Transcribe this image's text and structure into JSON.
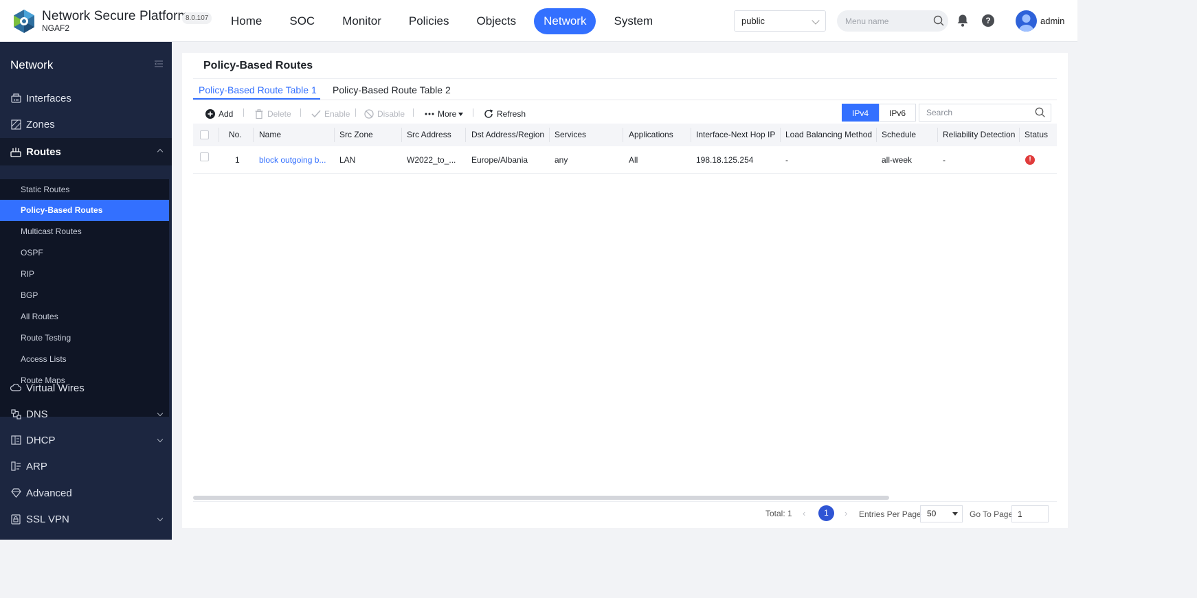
{
  "brand": {
    "title": "Network Secure Platform",
    "subtitle": "NGAF2",
    "version": "8.0.107"
  },
  "nav": {
    "items": [
      "Home",
      "SOC",
      "Monitor",
      "Policies",
      "Objects",
      "Network",
      "System"
    ],
    "active": "Network"
  },
  "header": {
    "vsys_value": "public",
    "search_placeholder": "Menu name",
    "help_glyph": "?",
    "username": "admin"
  },
  "sidebar": {
    "title": "Network",
    "items": [
      {
        "label": "Interfaces",
        "icon": "interfaces-icon"
      },
      {
        "label": "Zones",
        "icon": "zones-icon"
      },
      {
        "label": "Routes",
        "icon": "routes-icon",
        "expanded": true
      },
      {
        "label": "Virtual Wires",
        "icon": "virtual-wires-icon"
      },
      {
        "label": "DNS",
        "icon": "dns-icon"
      },
      {
        "label": "DHCP",
        "icon": "dhcp-icon"
      },
      {
        "label": "ARP",
        "icon": "arp-icon"
      },
      {
        "label": "Advanced",
        "icon": "advanced-icon"
      },
      {
        "label": "SSL VPN",
        "icon": "ssl-vpn-icon"
      }
    ],
    "routes_sub": [
      "Static Routes",
      "Policy-Based Routes",
      "Multicast Routes",
      "OSPF",
      "RIP",
      "BGP",
      "All Routes",
      "Route Testing",
      "Access Lists",
      "Route Maps"
    ],
    "active_sub": "Policy-Based Routes"
  },
  "page": {
    "title": "Policy-Based Routes",
    "tabs": [
      "Policy-Based Route Table 1",
      "Policy-Based Route Table 2"
    ]
  },
  "toolbar": {
    "add": "Add",
    "delete": "Delete",
    "enable": "Enable",
    "disable": "Disable",
    "more": "More",
    "refresh": "Refresh",
    "ipv4": "IPv4",
    "ipv6": "IPv6",
    "search_placeholder": "Search"
  },
  "table": {
    "headers": [
      "No.",
      "Name",
      "Src Zone",
      "Src Address",
      "Dst Address/Region",
      "Services",
      "Applications",
      "Interface-Next Hop IP",
      "Load Balancing Method",
      "Schedule",
      "Reliability Detection",
      "Status"
    ],
    "rows": [
      {
        "no": "1",
        "name": "block outgoing b...",
        "src_zone": "LAN",
        "src_address": "W2022_to_...",
        "dst": "Europe/Albania",
        "services": "any",
        "applications": "All",
        "next_hop": "198.18.125.254",
        "lb_method": "-",
        "schedule": "all-week",
        "reliability": "-",
        "status_glyph": "!"
      }
    ]
  },
  "pagination": {
    "total": "Total: 1",
    "prev": "‹",
    "current": "1",
    "next": "›",
    "entries_label": "Entries Per Page",
    "entries_value": "50",
    "goto_label": "Go To Page",
    "goto_value": "1"
  },
  "colors": {
    "accent": "#3370ff",
    "sidebar_bg": "#1c2640",
    "error": "#e03c3c"
  }
}
